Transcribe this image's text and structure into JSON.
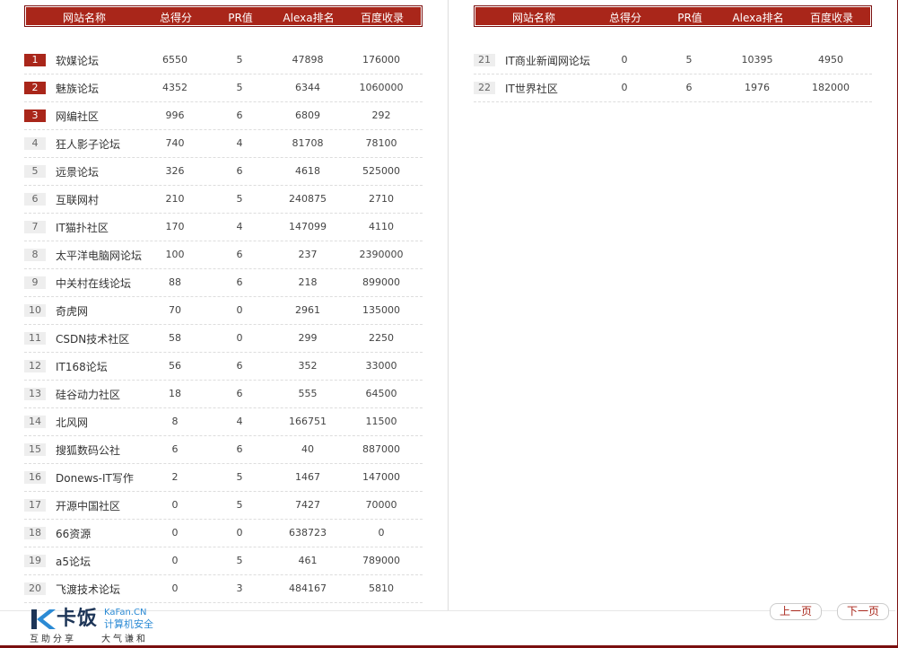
{
  "columns": [
    "网站名称",
    "总得分",
    "PR值",
    "Alexa排名",
    "百度收录"
  ],
  "left_rows": [
    {
      "rank": "1",
      "name": "软媒论坛",
      "score": "6550",
      "pr": "5",
      "alexa": "47898",
      "baidu": "176000"
    },
    {
      "rank": "2",
      "name": "魅族论坛",
      "score": "4352",
      "pr": "5",
      "alexa": "6344",
      "baidu": "1060000"
    },
    {
      "rank": "3",
      "name": "网编社区",
      "score": "996",
      "pr": "6",
      "alexa": "6809",
      "baidu": "292"
    },
    {
      "rank": "4",
      "name": "狂人影子论坛",
      "score": "740",
      "pr": "4",
      "alexa": "81708",
      "baidu": "78100"
    },
    {
      "rank": "5",
      "name": "远景论坛",
      "score": "326",
      "pr": "6",
      "alexa": "4618",
      "baidu": "525000"
    },
    {
      "rank": "6",
      "name": "互联网村",
      "score": "210",
      "pr": "5",
      "alexa": "240875",
      "baidu": "2710"
    },
    {
      "rank": "7",
      "name": "IT猫扑社区",
      "score": "170",
      "pr": "4",
      "alexa": "147099",
      "baidu": "4110"
    },
    {
      "rank": "8",
      "name": "太平洋电脑网论坛",
      "score": "100",
      "pr": "6",
      "alexa": "237",
      "baidu": "2390000"
    },
    {
      "rank": "9",
      "name": "中关村在线论坛",
      "score": "88",
      "pr": "6",
      "alexa": "218",
      "baidu": "899000"
    },
    {
      "rank": "10",
      "name": "奇虎网",
      "score": "70",
      "pr": "0",
      "alexa": "2961",
      "baidu": "135000"
    },
    {
      "rank": "11",
      "name": "CSDN技术社区",
      "score": "58",
      "pr": "0",
      "alexa": "299",
      "baidu": "2250"
    },
    {
      "rank": "12",
      "name": "IT168论坛",
      "score": "56",
      "pr": "6",
      "alexa": "352",
      "baidu": "33000"
    },
    {
      "rank": "13",
      "name": "硅谷动力社区",
      "score": "18",
      "pr": "6",
      "alexa": "555",
      "baidu": "64500"
    },
    {
      "rank": "14",
      "name": "北风网",
      "score": "8",
      "pr": "4",
      "alexa": "166751",
      "baidu": "11500"
    },
    {
      "rank": "15",
      "name": "搜狐数码公社",
      "score": "6",
      "pr": "6",
      "alexa": "40",
      "baidu": "887000"
    },
    {
      "rank": "16",
      "name": "Donews-IT写作",
      "score": "2",
      "pr": "5",
      "alexa": "1467",
      "baidu": "147000"
    },
    {
      "rank": "17",
      "name": "开源中国社区",
      "score": "0",
      "pr": "5",
      "alexa": "7427",
      "baidu": "70000"
    },
    {
      "rank": "18",
      "name": "66资源",
      "score": "0",
      "pr": "0",
      "alexa": "638723",
      "baidu": "0"
    },
    {
      "rank": "19",
      "name": "a5论坛",
      "score": "0",
      "pr": "5",
      "alexa": "461",
      "baidu": "789000"
    },
    {
      "rank": "20",
      "name": "飞渡技术论坛",
      "score": "0",
      "pr": "3",
      "alexa": "484167",
      "baidu": "5810"
    }
  ],
  "right_rows": [
    {
      "rank": "21",
      "name": "IT商业新闻网论坛",
      "score": "0",
      "pr": "5",
      "alexa": "10395",
      "baidu": "4950"
    },
    {
      "rank": "22",
      "name": "IT世界社区",
      "score": "0",
      "pr": "6",
      "alexa": "1976",
      "baidu": "182000"
    }
  ],
  "pager": {
    "prev": "上一页",
    "next": "下一页"
  },
  "logo": {
    "brand": "卡饭",
    "site": "KaFan.CN",
    "security": "计算机安全",
    "tagline_left": "互助分享",
    "tagline_right": "大气谦和"
  },
  "colors": {
    "accent": "#a9261a",
    "accent_dark": "#7a0f0f",
    "logo_blue": "#2b8ad4"
  }
}
